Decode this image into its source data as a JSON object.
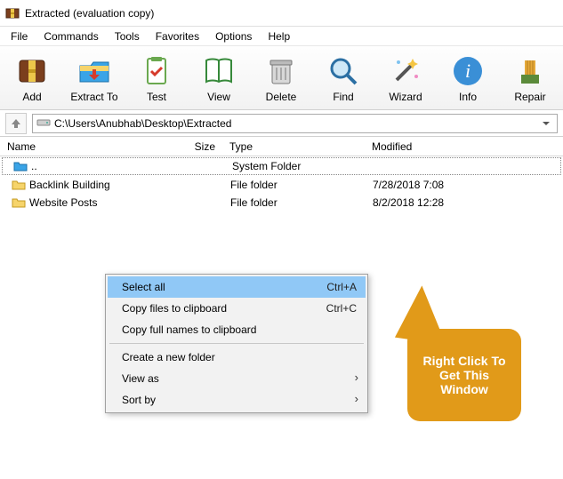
{
  "window": {
    "title": "Extracted (evaluation copy)"
  },
  "menu": {
    "items": [
      "File",
      "Commands",
      "Tools",
      "Favorites",
      "Options",
      "Help"
    ]
  },
  "toolbar": {
    "buttons": [
      {
        "name": "add",
        "label": "Add"
      },
      {
        "name": "extract",
        "label": "Extract To"
      },
      {
        "name": "test",
        "label": "Test"
      },
      {
        "name": "view",
        "label": "View"
      },
      {
        "name": "delete",
        "label": "Delete"
      },
      {
        "name": "find",
        "label": "Find"
      },
      {
        "name": "wizard",
        "label": "Wizard"
      },
      {
        "name": "info",
        "label": "Info"
      },
      {
        "name": "repair",
        "label": "Repair"
      }
    ]
  },
  "path": {
    "value": "C:\\Users\\Anubhab\\Desktop\\Extracted"
  },
  "columns": {
    "name": "Name",
    "size": "Size",
    "type": "Type",
    "modified": "Modified"
  },
  "rows": [
    {
      "icon": "parent",
      "name": "..",
      "size": "",
      "type": "System Folder",
      "modified": ""
    },
    {
      "icon": "folder",
      "name": "Backlink Building",
      "size": "",
      "type": "File folder",
      "modified": "7/28/2018 7:08"
    },
    {
      "icon": "folder",
      "name": "Website Posts",
      "size": "",
      "type": "File folder",
      "modified": "8/2/2018 12:28"
    }
  ],
  "context_menu": {
    "items": [
      {
        "label": "Select all",
        "shortcut": "Ctrl+A",
        "hl": true
      },
      {
        "label": "Copy files to clipboard",
        "shortcut": "Ctrl+C"
      },
      {
        "label": "Copy full names to clipboard",
        "shortcut": ""
      },
      {
        "sep": true
      },
      {
        "label": "Create a new folder",
        "shortcut": ""
      },
      {
        "label": "View as",
        "shortcut": "",
        "sub": true
      },
      {
        "label": "Sort by",
        "shortcut": "",
        "sub": true
      }
    ]
  },
  "callout": {
    "text": "Right Click To Get This Window"
  }
}
